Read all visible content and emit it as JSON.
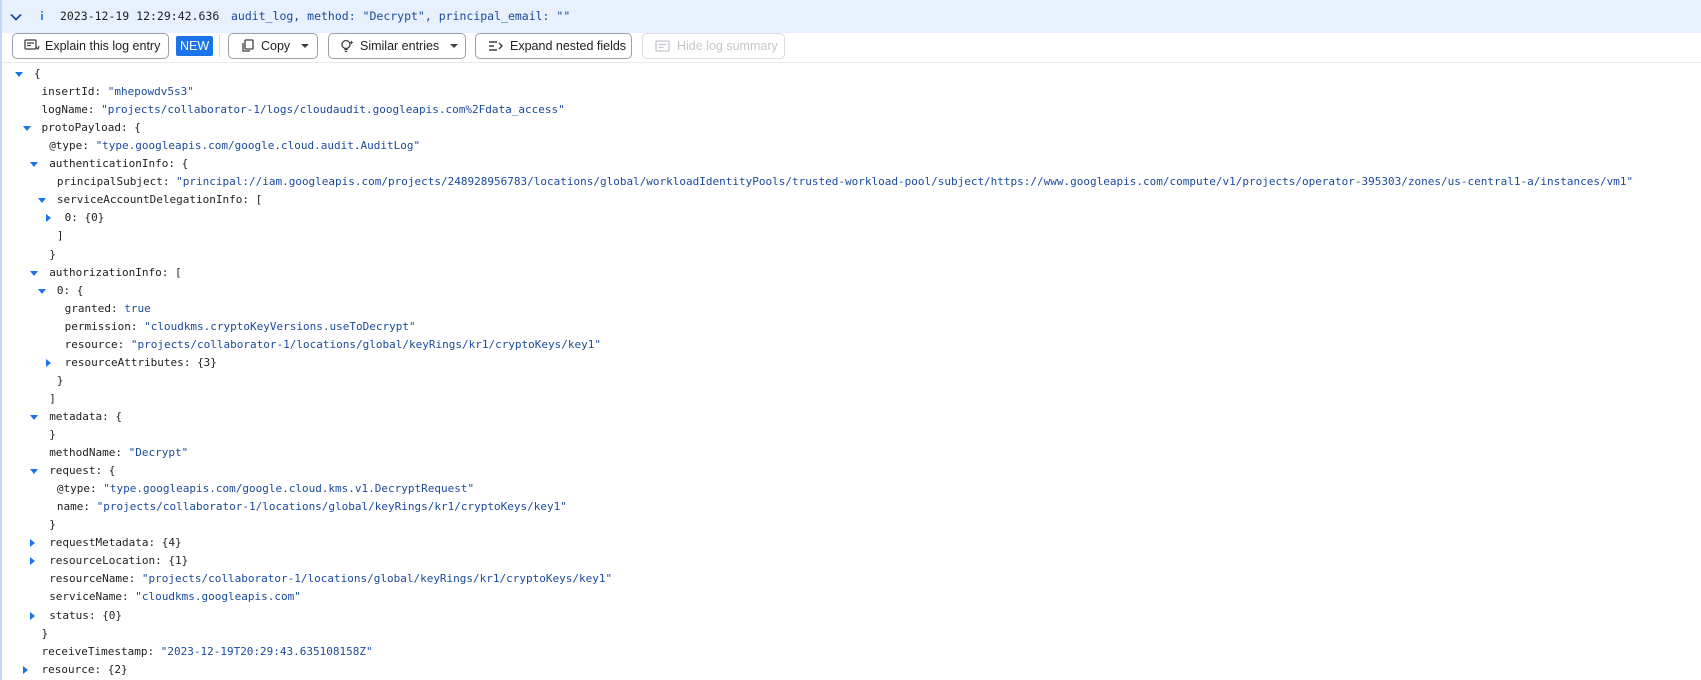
{
  "summary": {
    "timestamp": "2023-12-19 12:29:42.636",
    "text": "audit_log, method: \"Decrypt\", principal_email: \"\"",
    "severity_icon": "info-icon"
  },
  "toolbar": {
    "explain_label": "Explain this log entry",
    "new_badge": "NEW",
    "copy_label": "Copy",
    "similar_label": "Similar entries",
    "expand_label": "Expand nested fields",
    "hide_label": "Hide log summary"
  },
  "tree": [
    {
      "toggle": "down",
      "open": "{",
      "indent": 0
    },
    {
      "key": "insertId",
      "value": "\"mhepowdv5s3\"",
      "vtype": "string",
      "indent": 1
    },
    {
      "key": "logName",
      "value": "\"projects/collaborator-1/logs/cloudaudit.googleapis.com%2Fdata_access\"",
      "vtype": "string",
      "indent": 1
    },
    {
      "toggle": "down",
      "key": "protoPayload",
      "open": "{",
      "indent": 1
    },
    {
      "key": "@type",
      "value": "\"type.googleapis.com/google.cloud.audit.AuditLog\"",
      "vtype": "string",
      "indent": 2
    },
    {
      "toggle": "down",
      "key": "authenticationInfo",
      "open": "{",
      "indent": 2
    },
    {
      "key": "principalSubject",
      "value": "\"principal://iam.googleapis.com/projects/248928956783/locations/global/workloadIdentityPools/trusted-workload-pool/subject/https://www.googleapis.com/compute/v1/projects/operator-395303/zones/us-central1-a/instances/vm1\"",
      "vtype": "string",
      "indent": 3
    },
    {
      "toggle": "down",
      "key": "serviceAccountDelegationInfo",
      "open": "[",
      "indent": 3
    },
    {
      "toggle": "right",
      "key": "0",
      "open": "{0}",
      "indent": 4
    },
    {
      "close": "]",
      "indent": 3
    },
    {
      "close": "}",
      "indent": 2
    },
    {
      "toggle": "down",
      "key": "authorizationInfo",
      "open": "[",
      "indent": 2
    },
    {
      "toggle": "down",
      "key": "0",
      "open": "{",
      "indent": 3
    },
    {
      "key": "granted",
      "value": "true",
      "vtype": "bool",
      "indent": 4
    },
    {
      "key": "permission",
      "value": "\"cloudkms.cryptoKeyVersions.useToDecrypt\"",
      "vtype": "string",
      "indent": 4
    },
    {
      "key": "resource",
      "value": "\"projects/collaborator-1/locations/global/keyRings/kr1/cryptoKeys/key1\"",
      "vtype": "string",
      "indent": 4
    },
    {
      "toggle": "right",
      "key": "resourceAttributes",
      "open": "{3}",
      "indent": 4
    },
    {
      "close": "}",
      "indent": 3
    },
    {
      "close": "]",
      "indent": 2
    },
    {
      "toggle": "down",
      "key": "metadata",
      "open": "{",
      "indent": 2
    },
    {
      "close": "}",
      "indent": 2
    },
    {
      "key": "methodName",
      "value": "\"Decrypt\"",
      "vtype": "string",
      "indent": 2
    },
    {
      "toggle": "down",
      "key": "request",
      "open": "{",
      "indent": 2
    },
    {
      "key": "@type",
      "value": "\"type.googleapis.com/google.cloud.kms.v1.DecryptRequest\"",
      "vtype": "string",
      "indent": 3
    },
    {
      "key": "name",
      "value": "\"projects/collaborator-1/locations/global/keyRings/kr1/cryptoKeys/key1\"",
      "vtype": "string",
      "indent": 3
    },
    {
      "close": "}",
      "indent": 2
    },
    {
      "toggle": "right",
      "key": "requestMetadata",
      "open": "{4}",
      "indent": 2
    },
    {
      "toggle": "right",
      "key": "resourceLocation",
      "open": "{1}",
      "indent": 2
    },
    {
      "key": "resourceName",
      "value": "\"projects/collaborator-1/locations/global/keyRings/kr1/cryptoKeys/key1\"",
      "vtype": "string",
      "indent": 2
    },
    {
      "key": "serviceName",
      "value": "\"cloudkms.googleapis.com\"",
      "vtype": "string",
      "indent": 2
    },
    {
      "toggle": "right",
      "key": "status",
      "open": "{0}",
      "indent": 2
    },
    {
      "close": "}",
      "indent": 1
    },
    {
      "key": "receiveTimestamp",
      "value": "\"2023-12-19T20:29:43.635108158Z\"",
      "vtype": "string",
      "indent": 1
    },
    {
      "toggle": "right",
      "key": "resource",
      "open": "{2}",
      "indent": 1
    }
  ]
}
